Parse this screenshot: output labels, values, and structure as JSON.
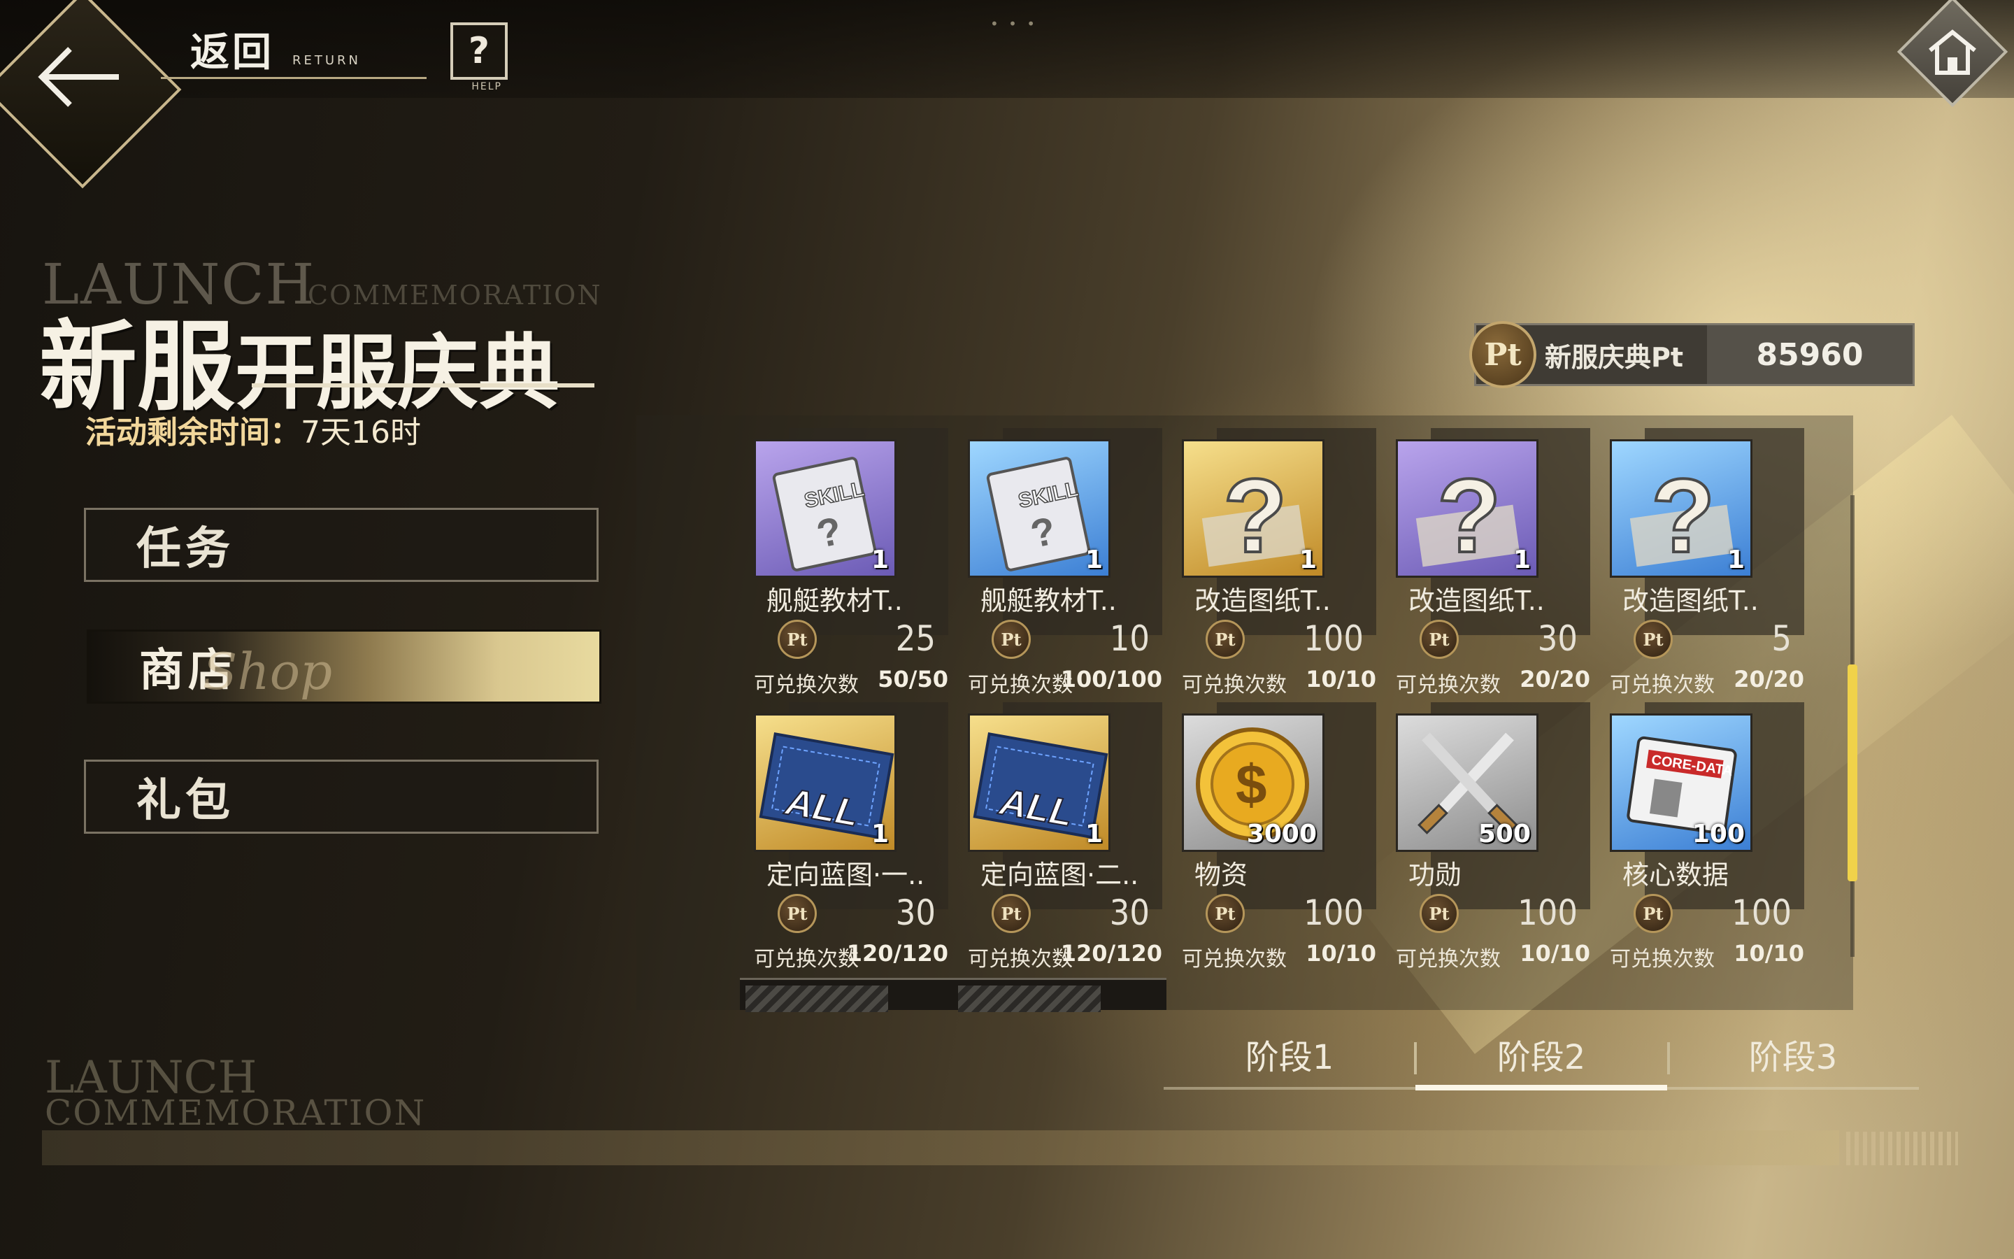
{
  "header": {
    "back_label": "返回",
    "back_sub": "RETURN",
    "help_label": "HELP",
    "help_symbol": "?"
  },
  "event": {
    "title_en": "LAUNCH",
    "title_en_sub": "COMMEMORATION",
    "title_a": "新服",
    "title_b": "开服庆典",
    "timer_label": "活动剩余时间：",
    "timer_value": "7天16时"
  },
  "nav": {
    "items": [
      {
        "label": "任务"
      },
      {
        "label": "商店",
        "sub": "Shop"
      },
      {
        "label": "礼包"
      }
    ],
    "active_index": 1
  },
  "watermark": {
    "line1": "LAUNCH",
    "line2": "COMMEMORATION"
  },
  "currency": {
    "coin_symbol": "Pt",
    "name": "新服庆典Pt",
    "value": "85960"
  },
  "shop": {
    "limit_label": "可兑换次数",
    "items": [
      {
        "name": "舰艇教材T..",
        "qty": "1",
        "price": "25",
        "limit": "50/50",
        "icon": "skill-book-icon",
        "bg": "purple"
      },
      {
        "name": "舰艇教材T..",
        "qty": "1",
        "price": "10",
        "limit": "100/100",
        "icon": "skill-book-icon",
        "bg": "blue"
      },
      {
        "name": "改造图纸T..",
        "qty": "1",
        "price": "100",
        "limit": "10/10",
        "icon": "blueprint-question-icon",
        "bg": "gold"
      },
      {
        "name": "改造图纸T..",
        "qty": "1",
        "price": "30",
        "limit": "20/20",
        "icon": "blueprint-question-icon",
        "bg": "purple"
      },
      {
        "name": "改造图纸T..",
        "qty": "1",
        "price": "5",
        "limit": "20/20",
        "icon": "blueprint-question-icon",
        "bg": "blue"
      },
      {
        "name": "定向蓝图·一..",
        "qty": "1",
        "price": "30",
        "limit": "120/120",
        "icon": "blueprint-all-icon",
        "bg": "gold"
      },
      {
        "name": "定向蓝图·二..",
        "qty": "1",
        "price": "30",
        "limit": "120/120",
        "icon": "blueprint-all-icon",
        "bg": "gold"
      },
      {
        "name": "物资",
        "qty": "3000",
        "price": "100",
        "limit": "10/10",
        "icon": "coin-icon",
        "bg": "gray"
      },
      {
        "name": "功勋",
        "qty": "500",
        "price": "100",
        "limit": "10/10",
        "icon": "crossed-swords-icon",
        "bg": "gray"
      },
      {
        "name": "核心数据",
        "qty": "100",
        "price": "100",
        "limit": "10/10",
        "icon": "core-data-icon",
        "bg": "blue"
      }
    ]
  },
  "stages": {
    "tabs": [
      {
        "label": "阶段1"
      },
      {
        "label": "阶段2"
      },
      {
        "label": "阶段3"
      }
    ],
    "active_index": 1
  },
  "colors": {
    "accent_gold": "#e8da9f",
    "scroll_thumb": "#f0d24a"
  }
}
